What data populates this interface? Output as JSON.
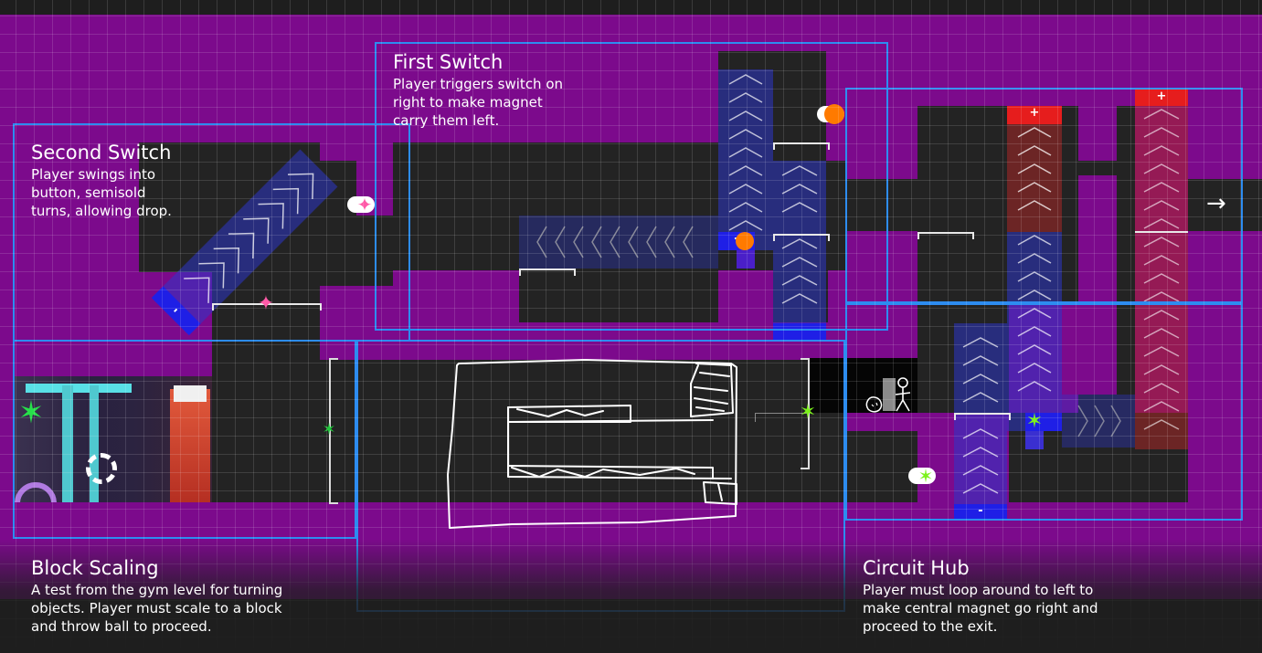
{
  "sections": [
    {
      "title": "Second Switch",
      "description": "Player swings into\nbutton, semisold\nturns, allowing drop."
    },
    {
      "title": "First Switch",
      "description": "Player triggers switch on\nright to make magnet\ncarry them left."
    },
    {
      "title": "Block Scaling",
      "description": "A test from the gym level for turning\nobjects. Player must scale to a block\nand throw ball to proceed."
    },
    {
      "title": "Circuit Hub",
      "description": "Player must loop around to left to\nmake central magnet go right and\nproceed to the exit."
    }
  ],
  "magnet_labels": {
    "negative": "-",
    "positive": "+"
  },
  "icons": {
    "switch_star": "pink-star-icon",
    "checkpoint_star": "green-star-icon",
    "exit_arrow": "right-arrow-icon",
    "player": "stick-figure-icon",
    "ball": "orange-ball-icon"
  },
  "colors": {
    "background_purple": "#7c0a8c",
    "wall": "#232323",
    "zone_border": "#2d8cf0",
    "negative_magnet": "#1f1fe6",
    "positive_magnet": "#e61d1d",
    "ball": "#ff7a00",
    "switch_star": "#ff5aa8",
    "checkpoint_star": "#7cf21c"
  },
  "exit_symbol": "→"
}
